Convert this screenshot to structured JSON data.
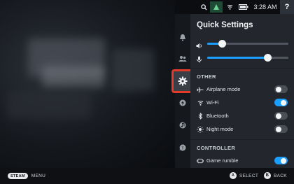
{
  "status_bar": {
    "time": "3:28 AM",
    "help": "?",
    "icons": [
      "search-icon",
      "steam-deck-icon",
      "wifi-icon",
      "battery-icon"
    ],
    "accent_color": "#1a9fff"
  },
  "rail": {
    "items": [
      "bell-icon",
      "friends-icon",
      "gear-icon",
      "lightning-icon",
      "music-icon",
      "help-circle-icon"
    ],
    "active_index": 2,
    "active_outline_color": "#e33a2a"
  },
  "panel": {
    "title": "Quick Settings",
    "volume_level": 0.18,
    "mic_level": 0.74,
    "sections": {
      "other": "OTHER",
      "controller": "CONTROLLER"
    },
    "toggles": [
      {
        "label": "Airplane mode",
        "icon": "airplane-icon",
        "on": false
      },
      {
        "label": "Wi-Fi",
        "icon": "wifi-icon",
        "on": true
      },
      {
        "label": "Bluetooth",
        "icon": "bluetooth-icon",
        "on": false
      },
      {
        "label": "Night mode",
        "icon": "sun-icon",
        "on": false
      }
    ],
    "controller_toggles": [
      {
        "label": "Game rumble",
        "icon": "rumble-icon",
        "on": true
      }
    ]
  },
  "bottom_bar": {
    "steam": "STEAM",
    "menu": "MENU",
    "a_button": "A",
    "select": "SELECT",
    "b_button": "B",
    "back": "BACK"
  }
}
